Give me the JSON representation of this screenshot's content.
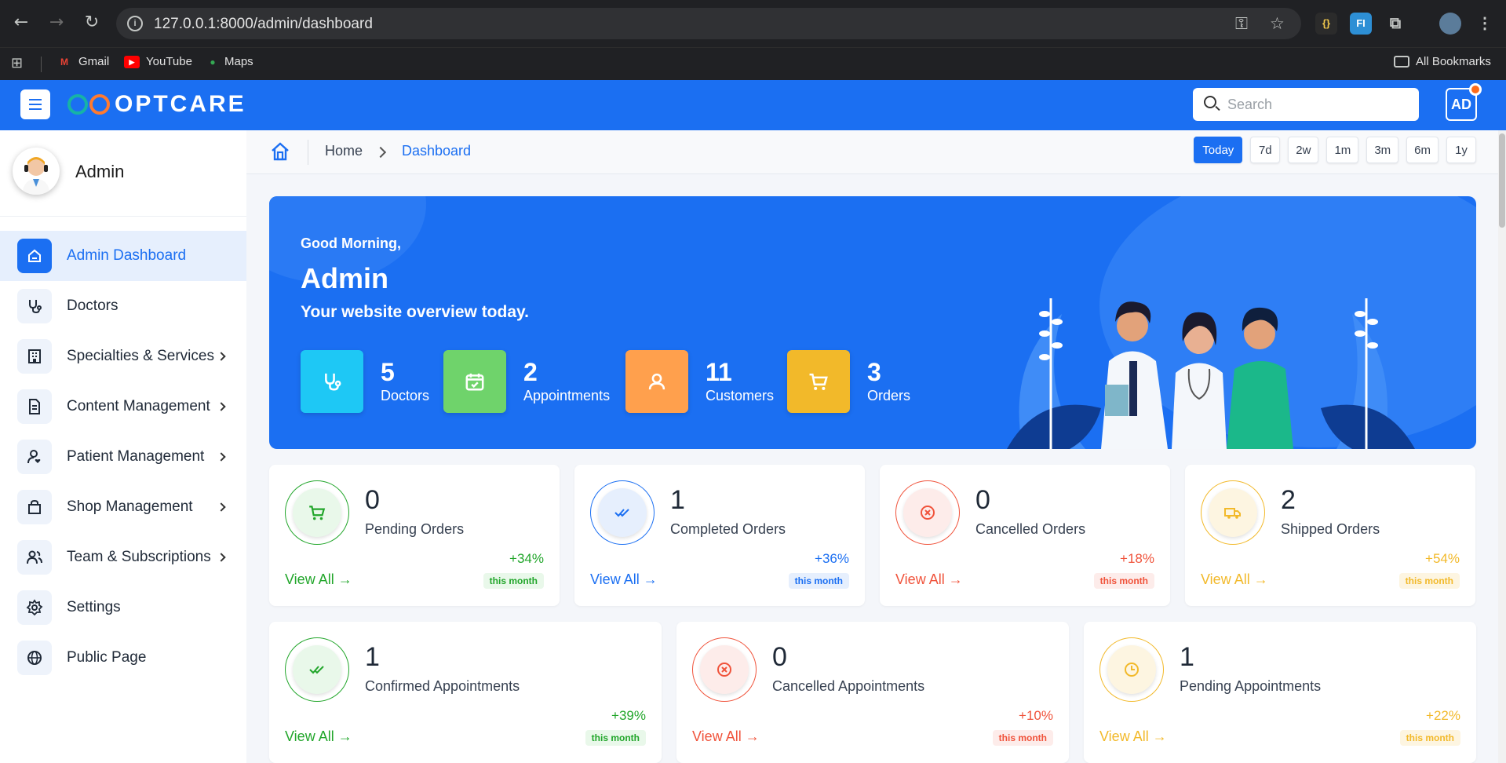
{
  "browser": {
    "url": "127.0.0.1:8000/admin/dashboard",
    "bookmarks": [
      {
        "label": "Gmail",
        "icon": "gmail-icon"
      },
      {
        "label": "YouTube",
        "icon": "youtube-icon"
      },
      {
        "label": "Maps",
        "icon": "maps-icon"
      }
    ],
    "all_bookmarks": "All Bookmarks"
  },
  "app": {
    "brand": "OPTCARE",
    "search_placeholder": "Search",
    "user_initials": "AD",
    "accent": "#1b6ff2"
  },
  "sidebar": {
    "profile_name": "Admin",
    "items": [
      {
        "label": "Admin Dashboard",
        "icon": "home-icon",
        "active": true,
        "submenu": false
      },
      {
        "label": "Doctors",
        "icon": "stethoscope-icon",
        "submenu": false
      },
      {
        "label": "Specialties & Services",
        "icon": "building-icon",
        "submenu": true
      },
      {
        "label": "Content Management",
        "icon": "document-icon",
        "submenu": true
      },
      {
        "label": "Patient Management",
        "icon": "patient-icon",
        "submenu": true
      },
      {
        "label": "Shop Management",
        "icon": "bag-icon",
        "submenu": true
      },
      {
        "label": "Team & Subscriptions",
        "icon": "team-icon",
        "submenu": true
      },
      {
        "label": "Settings",
        "icon": "gear-icon",
        "submenu": false
      },
      {
        "label": "Public Page",
        "icon": "globe-icon",
        "submenu": false
      }
    ]
  },
  "breadcrumb": {
    "home": "Home",
    "current": "Dashboard"
  },
  "ranges": [
    "Today",
    "7d",
    "2w",
    "1m",
    "3m",
    "6m",
    "1y"
  ],
  "active_range": "Today",
  "hero": {
    "greeting": "Good Morning,",
    "name": "Admin",
    "subtitle": "Your website overview today.",
    "stats": [
      {
        "value": "5",
        "label": "Doctors",
        "color": "#1ec8f5",
        "icon": "stethoscope-icon"
      },
      {
        "value": "2",
        "label": "Appointments",
        "color": "#6fd36b",
        "icon": "calendar-check-icon"
      },
      {
        "value": "11",
        "label": "Customers",
        "color": "#ffa04d",
        "icon": "user-icon"
      },
      {
        "value": "3",
        "label": "Orders",
        "color": "#f2b92a",
        "icon": "cart-icon"
      }
    ]
  },
  "order_cards": [
    {
      "value": "0",
      "label": "Pending Orders",
      "pct": "+34%",
      "link": "View All",
      "period": "this month",
      "color": "#22a62b",
      "bg": "#e9f8ea",
      "icon": "cart-icon"
    },
    {
      "value": "1",
      "label": "Completed Orders",
      "pct": "+36%",
      "link": "View All",
      "period": "this month",
      "color": "#1b6ff2",
      "bg": "#e6effd",
      "icon": "double-check-icon"
    },
    {
      "value": "0",
      "label": "Cancelled Orders",
      "pct": "+18%",
      "link": "View All",
      "period": "this month",
      "color": "#f0533b",
      "bg": "#fdecea",
      "icon": "x-circle-icon"
    },
    {
      "value": "2",
      "label": "Shipped Orders",
      "pct": "+54%",
      "link": "View All",
      "period": "this month",
      "color": "#f2b92a",
      "bg": "#fdf5e1",
      "icon": "truck-icon"
    }
  ],
  "appointment_cards": [
    {
      "value": "1",
      "label": "Confirmed Appointments",
      "pct": "+39%",
      "link": "View All",
      "period": "this month",
      "color": "#22a62b",
      "bg": "#e9f8ea",
      "icon": "double-check-icon"
    },
    {
      "value": "0",
      "label": "Cancelled Appointments",
      "pct": "+10%",
      "link": "View All",
      "period": "this month",
      "color": "#f0533b",
      "bg": "#fdecea",
      "icon": "x-circle-icon"
    },
    {
      "value": "1",
      "label": "Pending Appointments",
      "pct": "+22%",
      "link": "View All",
      "period": "this month",
      "color": "#f2b92a",
      "bg": "#fdf5e1",
      "icon": "clock-icon"
    }
  ]
}
